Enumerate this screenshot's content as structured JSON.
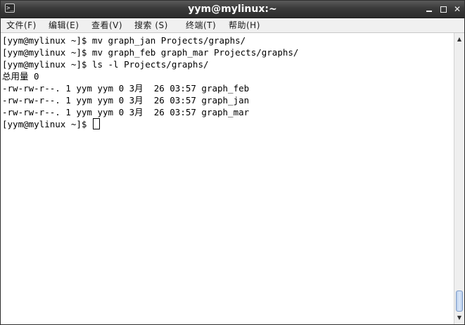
{
  "window": {
    "title": "yym@mylinux:~",
    "app_icon": "terminal-icon",
    "controls": {
      "minimize_icon": "minimize-icon",
      "maximize_icon": "maximize-icon",
      "close_glyph": "✕"
    }
  },
  "menu": {
    "items": [
      {
        "label": "文件(F)"
      },
      {
        "label": "编辑(E)"
      },
      {
        "label": "查看(V)"
      },
      {
        "label": "搜索 (S)"
      },
      {
        "label": "终端(T)"
      },
      {
        "label": "帮助(H)"
      }
    ]
  },
  "terminal": {
    "lines": [
      "[yym@mylinux ~]$ mv graph_jan Projects/graphs/",
      "[yym@mylinux ~]$ mv graph_feb graph_mar Projects/graphs/",
      "[yym@mylinux ~]$ ls -l Projects/graphs/",
      "总用量 0",
      "-rw-rw-r--. 1 yym yym 0 3月  26 03:57 graph_feb",
      "-rw-rw-r--. 1 yym yym 0 3月  26 03:57 graph_jan",
      "-rw-rw-r--. 1 yym yym 0 3月  26 03:57 graph_mar"
    ],
    "prompt": "[yym@mylinux ~]$ "
  },
  "scrollbar": {
    "up_glyph": "▲",
    "down_glyph": "▼",
    "thumb_start_fraction": 0.92,
    "thumb_size_fraction": 0.08
  },
  "colors": {
    "titlebar": "#3a3a3a",
    "menubar": "#f0f0f0",
    "terminal_bg": "#ffffff",
    "terminal_fg": "#000000",
    "scroll_thumb": "#b6ccec"
  }
}
